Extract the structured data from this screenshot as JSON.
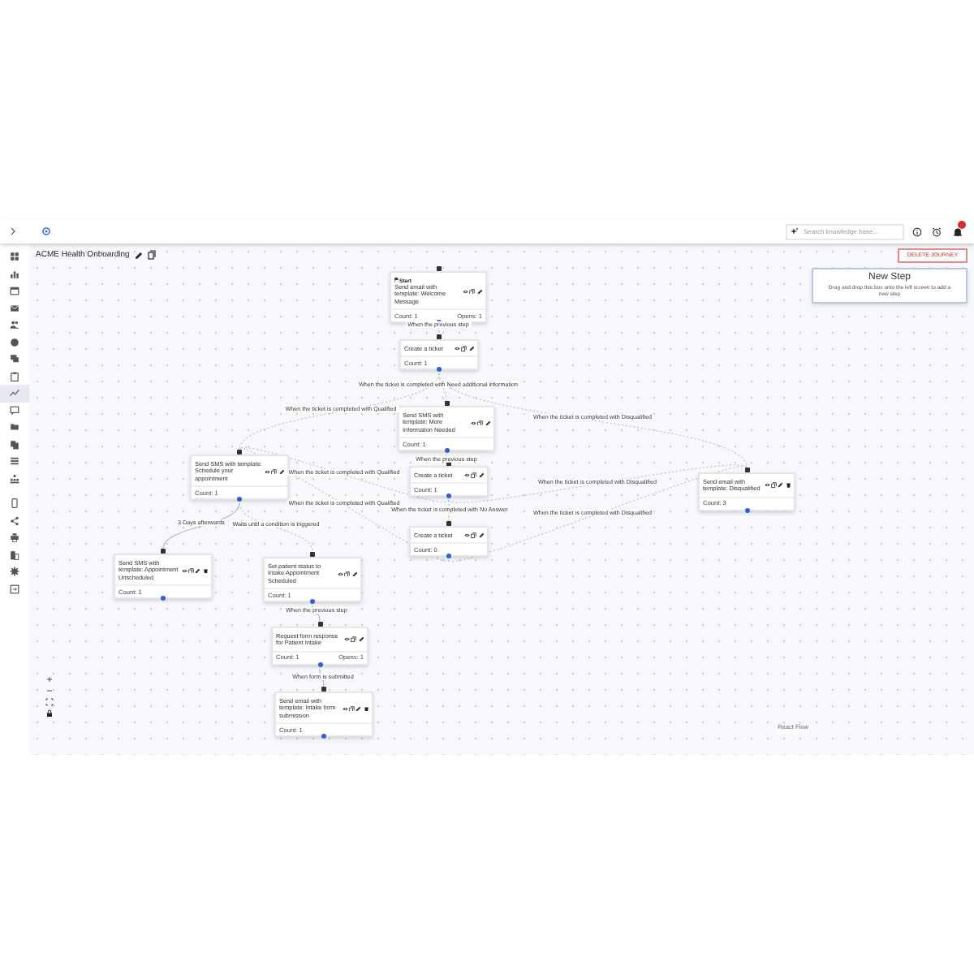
{
  "header": {
    "search": {
      "placeholder": "Search knowledge base..."
    }
  },
  "sidebar": {
    "items": [
      {
        "selected": false
      },
      {
        "selected": false
      },
      {
        "selected": false
      },
      {
        "selected": false
      },
      {
        "selected": false
      },
      {
        "selected": false
      },
      {
        "selected": false
      },
      {
        "selected": false
      },
      {
        "selected": true
      },
      {
        "selected": false
      },
      {
        "selected": false
      },
      {
        "selected": false
      },
      {
        "selected": false
      },
      {
        "selected": false
      },
      {
        "selected": false
      },
      {
        "selected": false
      },
      {
        "selected": false
      },
      {
        "selected": false
      },
      {
        "selected": false
      },
      {
        "selected": false
      }
    ]
  },
  "journey": {
    "title": "ACME Health Onboarding",
    "delete_button": "DELETE JOURNEY"
  },
  "new_step": {
    "title": "New Step",
    "hint": "Drag and drop this box onto the left screen to add a new step"
  },
  "nodes": [
    {
      "badge": "Start",
      "text": "Send email with template: Welcome Message",
      "deletable": false,
      "count": "Count: 1",
      "opens": "Opens: 1"
    },
    {
      "text": "Create a ticket",
      "deletable": false,
      "count": "Count: 1"
    },
    {
      "text": "Send SMS with template: More Information Needed",
      "deletable": false,
      "count": "Count: 1"
    },
    {
      "text": "Send SMS with template: Schedule your appointment",
      "deletable": false,
      "count": "Count: 1"
    },
    {
      "text": "Create a ticket",
      "deletable": false,
      "count": "Count: 1"
    },
    {
      "text": "Send email with template: Disqualified",
      "deletable": true,
      "count": "Count: 3"
    },
    {
      "text": "Create a ticket",
      "deletable": false,
      "count": "Count: 0"
    },
    {
      "text": "Send SMS with template: Appointment Unscheduled",
      "deletable": true,
      "count": "Count: 1"
    },
    {
      "text": "Set patient status to Intake Appointment Scheduled",
      "deletable": false,
      "count": "Count: 1"
    },
    {
      "text": "Request form response for Patient Intake",
      "deletable": false,
      "count": "Count: 1",
      "opens": "Opens: 1"
    },
    {
      "text": "Send email with template: Intake form submission",
      "deletable": true,
      "count": "Count: 1"
    }
  ],
  "edges": [
    {
      "label": "When the previous step"
    },
    {
      "label": "When the ticket is completed with Need additional information"
    },
    {
      "label": "When the ticket is completed with Qualified"
    },
    {
      "label": "When the ticket is completed with Disqualified"
    },
    {
      "label": "When the previous step"
    },
    {
      "label": "When the ticket is completed with Qualified"
    },
    {
      "label": "When the ticket is completed with Disqualified"
    },
    {
      "label": "When the ticket is completed with Qualified"
    },
    {
      "label": "When the ticket is completed with No Answer"
    },
    {
      "label": "When the ticket is completed with Disqualified"
    },
    {
      "label": "3 Days afterwards"
    },
    {
      "label": "Waits until a condition is triggered"
    },
    {
      "label": "When the previous step"
    },
    {
      "label": "When form is submitted"
    }
  ],
  "attribution": "React Flow"
}
